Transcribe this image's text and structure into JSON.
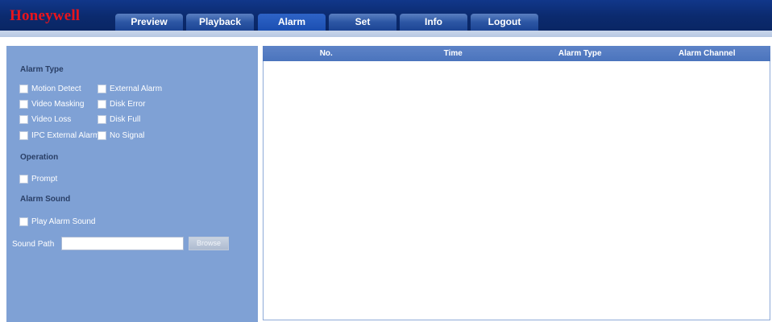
{
  "brand": "Honeywell",
  "nav": [
    {
      "label": "Preview",
      "active": false
    },
    {
      "label": "Playback",
      "active": false
    },
    {
      "label": "Alarm",
      "active": true
    },
    {
      "label": "Set",
      "active": false
    },
    {
      "label": "Info",
      "active": false
    },
    {
      "label": "Logout",
      "active": false
    }
  ],
  "alarm_type": {
    "title": "Alarm Type",
    "options": [
      "Motion Detect",
      "External Alarm",
      "Video Masking",
      "Disk Error",
      "Video Loss",
      "Disk Full",
      "IPC External Alarm",
      "No Signal"
    ]
  },
  "operation": {
    "title": "Operation",
    "prompt_label": "Prompt"
  },
  "alarm_sound": {
    "title": "Alarm Sound",
    "play_label": "Play Alarm Sound",
    "path_label": "Sound Path",
    "path_value": "",
    "browse_label": "Browse"
  },
  "table": {
    "columns": [
      "No.",
      "Time",
      "Alarm Type",
      "Alarm Channel"
    ]
  },
  "colors": {
    "accent": "#e8141c",
    "panel": "#7fa1d5",
    "header": "#0b2a6e"
  }
}
